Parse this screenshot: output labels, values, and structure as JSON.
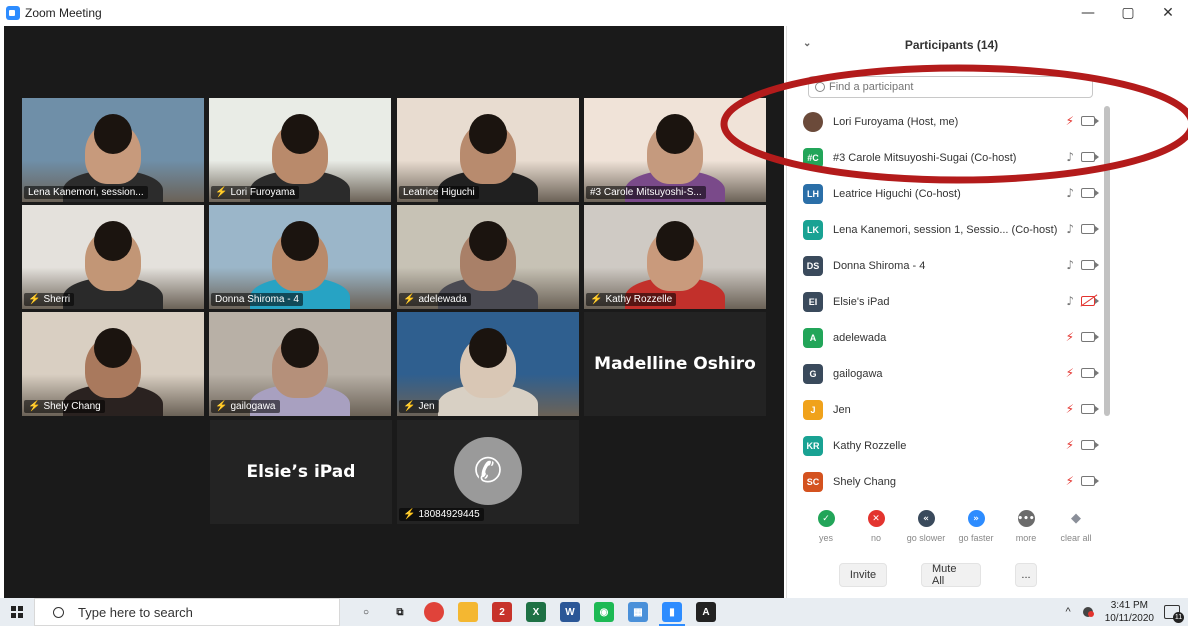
{
  "window": {
    "title": "Zoom Meeting",
    "minimize": "—",
    "restore": "▢",
    "close": "✕"
  },
  "tiles": [
    {
      "name": "Lena Kanemori, session...",
      "muted": false,
      "skin": "#c79a7c",
      "bg": "#6f8fa8",
      "shirt": "#2c2c2c"
    },
    {
      "name": "Lori Furoyama",
      "muted": true,
      "skin": "#b98a6b",
      "bg": "#e9ece6",
      "shirt": "#2b2b2b"
    },
    {
      "name": "Leatrice Higuchi",
      "muted": false,
      "skin": "#b88b6e",
      "bg": "#e8dcd0",
      "shirt": "#202020"
    },
    {
      "name": "#3 Carole Mitsuyoshi-S...",
      "muted": false,
      "skin": "#c59a7e",
      "bg": "#f0e3d8",
      "shirt": "#7a4a8a"
    },
    {
      "name": "Sherri",
      "muted": true,
      "skin": "#c29676",
      "bg": "#e4e1dc",
      "shirt": "#2a2a2a"
    },
    {
      "name": "Donna Shiroma - 4",
      "muted": false,
      "skin": "#b98a6a",
      "bg": "#9bb6c9",
      "shirt": "#27a3c4",
      "active": true
    },
    {
      "name": "adelewada",
      "muted": true,
      "skin": "#a98068",
      "bg": "#c7c2b5",
      "shirt": "#4a4a52"
    },
    {
      "name": "Kathy Rozzelle",
      "muted": true,
      "skin": "#c99a7c",
      "bg": "#cfcac4",
      "shirt": "#c2302b"
    },
    {
      "name": "Shely Chang",
      "muted": true,
      "skin": "#a9795d",
      "bg": "#d9cfc2",
      "shirt": "#2a2220"
    },
    {
      "name": "gailogawa",
      "muted": true,
      "skin": "#b5907a",
      "bg": "#b8b0a6",
      "shirt": "#a8a0c0"
    },
    {
      "name": "Jen",
      "muted": true,
      "skin": "#d9c7b5",
      "bg": "#2f5f8f",
      "shirt": "#d8d0c4"
    }
  ],
  "text_tiles": {
    "madelline": "Madelline Oshiro",
    "elsie": "Elsie’s iPad",
    "phone": "18084929445"
  },
  "panel": {
    "collapse_icon": "⌄",
    "title": "Participants (14)",
    "search_placeholder": "Find a participant",
    "participants": [
      {
        "initials": "",
        "name": "Lori Furoyama (Host, me)",
        "color": "#6b4a3a",
        "photo": true,
        "mic": "off",
        "cam": "on"
      },
      {
        "initials": "#C",
        "name": "#3 Carole Mitsuyoshi-Sugai (Co-host)",
        "color": "#22a559",
        "mic": "on",
        "cam": "on"
      },
      {
        "initials": "LH",
        "name": "Leatrice Higuchi (Co-host)",
        "color": "#2b6fa8",
        "mic": "on",
        "cam": "on"
      },
      {
        "initials": "LK",
        "name": "Lena Kanemori, session 1, Sessio... (Co-host)",
        "color": "#19a293",
        "mic": "on",
        "cam": "on"
      },
      {
        "initials": "DS",
        "name": "Donna Shiroma - 4",
        "color": "#3a4a5c",
        "mic": "on",
        "cam": "on"
      },
      {
        "initials": "EI",
        "name": "Elsie's iPad",
        "color": "#3a4a5c",
        "mic": "on",
        "cam": "off"
      },
      {
        "initials": "A",
        "name": "adelewada",
        "color": "#22a559",
        "mic": "off",
        "cam": "on"
      },
      {
        "initials": "G",
        "name": "gailogawa",
        "color": "#3a4a5c",
        "mic": "off",
        "cam": "on"
      },
      {
        "initials": "J",
        "name": "Jen",
        "color": "#f0a21b",
        "mic": "off",
        "cam": "on"
      },
      {
        "initials": "KR",
        "name": "Kathy Rozzelle",
        "color": "#19a293",
        "mic": "off",
        "cam": "on"
      },
      {
        "initials": "SC",
        "name": "Shely Chang",
        "color": "#d4521f",
        "mic": "off",
        "cam": "on"
      }
    ],
    "reactions": [
      {
        "label": "yes",
        "glyph": "✓",
        "color": "#22a559"
      },
      {
        "label": "no",
        "glyph": "✕",
        "color": "#e3342f"
      },
      {
        "label": "go slower",
        "glyph": "«",
        "color": "#3a4a5c"
      },
      {
        "label": "go faster",
        "glyph": "»",
        "color": "#2d8cff"
      },
      {
        "label": "more",
        "glyph": "•••",
        "color": "#6b6b6b"
      },
      {
        "label": "clear all",
        "glyph": "◆",
        "color": "#8a8f99"
      }
    ],
    "invite": "Invite",
    "mute_all": "Mute All",
    "more": "..."
  },
  "taskbar": {
    "search_placeholder": "Type here to search",
    "apps": [
      {
        "name": "cortana",
        "glyph": "○",
        "color": "transparent",
        "fg": "#222"
      },
      {
        "name": "task-view",
        "glyph": "⧉",
        "color": "transparent",
        "fg": "#222"
      },
      {
        "name": "chrome",
        "glyph": "",
        "color": "#e0433a",
        "fg": "#fff"
      },
      {
        "name": "file-explorer",
        "glyph": "",
        "color": "#f4b731",
        "fg": "#fff"
      },
      {
        "name": "app-red",
        "glyph": "2",
        "color": "#c7332b",
        "fg": "#fff"
      },
      {
        "name": "excel",
        "glyph": "X",
        "color": "#1e7145",
        "fg": "#fff"
      },
      {
        "name": "word",
        "glyph": "W",
        "color": "#2b5797",
        "fg": "#fff"
      },
      {
        "name": "spotify",
        "glyph": "◉",
        "color": "#1db954",
        "fg": "#fff"
      },
      {
        "name": "app-grid",
        "glyph": "▦",
        "color": "#4a90d9",
        "fg": "#fff"
      },
      {
        "name": "zoom",
        "glyph": "▮",
        "color": "#2d8cff",
        "fg": "#fff"
      },
      {
        "name": "acrobat",
        "glyph": "A",
        "color": "#222",
        "fg": "#fff"
      }
    ],
    "time": "3:41 PM",
    "date": "10/11/2020",
    "notif_count": "11",
    "tray_caret": "^"
  },
  "colors": {
    "annotation": "#b31b1b",
    "active_speaker": "#cddc39"
  }
}
